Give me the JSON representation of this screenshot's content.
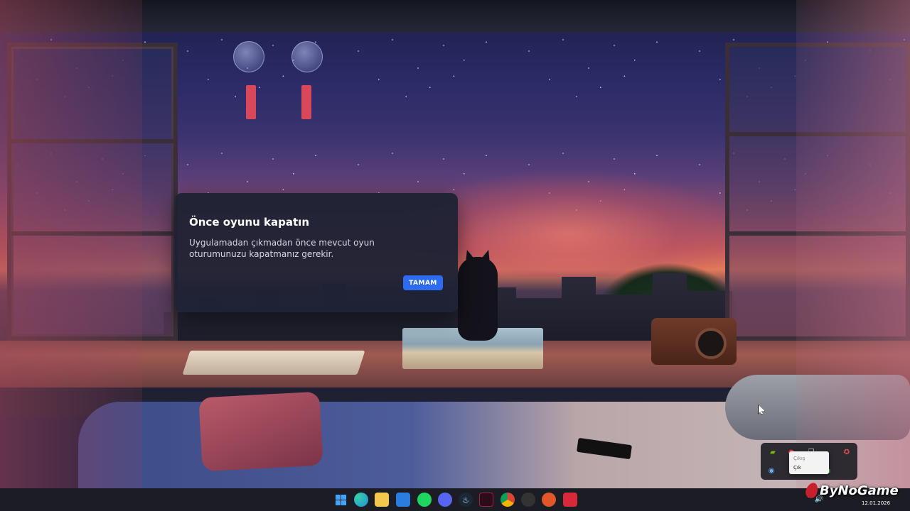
{
  "dialog": {
    "title": "Önce oyunu kapatın",
    "message": "Uygulamadan çıkmadan önce mevcut oyun oturumunuzu kapatmanız gerekir.",
    "ok_button": "TAMAM"
  },
  "context_menu": {
    "items": [
      {
        "label": "Çıkış",
        "state": "dim"
      },
      {
        "label": "Çık",
        "state": "normal"
      }
    ]
  },
  "tray_overflow_icons": [
    "nvidia-icon",
    "record-icon",
    "copy-icon",
    "app-icon",
    "steam-icon",
    "network-icon"
  ],
  "taskbar": {
    "apps": [
      {
        "name": "windows-start-icon",
        "color": "#3fa6ff"
      },
      {
        "name": "edge-icon",
        "color": "#1f8fd6"
      },
      {
        "name": "file-explorer-icon",
        "color": "#f2c94c"
      },
      {
        "name": "microsoft-store-icon",
        "color": "#2a7ce0"
      },
      {
        "name": "spotify-icon",
        "color": "#1ed760"
      },
      {
        "name": "discord-icon",
        "color": "#5865f2"
      },
      {
        "name": "steam-icon",
        "color": "#1b2838"
      },
      {
        "name": "affinity-icon",
        "color": "#7a1f3f"
      },
      {
        "name": "chrome-icon",
        "color": "#f4b400"
      },
      {
        "name": "game-launcher-icon",
        "color": "#444444"
      },
      {
        "name": "fire-app-icon",
        "color": "#e2572a"
      },
      {
        "name": "red-app-icon",
        "color": "#d62a3a"
      }
    ]
  },
  "watermark": {
    "text": "ByNoGame"
  },
  "clock": {
    "date": "12.01.2026"
  },
  "colors": {
    "dialog_bg": "#1e2234",
    "accent": "#2d6cf0"
  }
}
